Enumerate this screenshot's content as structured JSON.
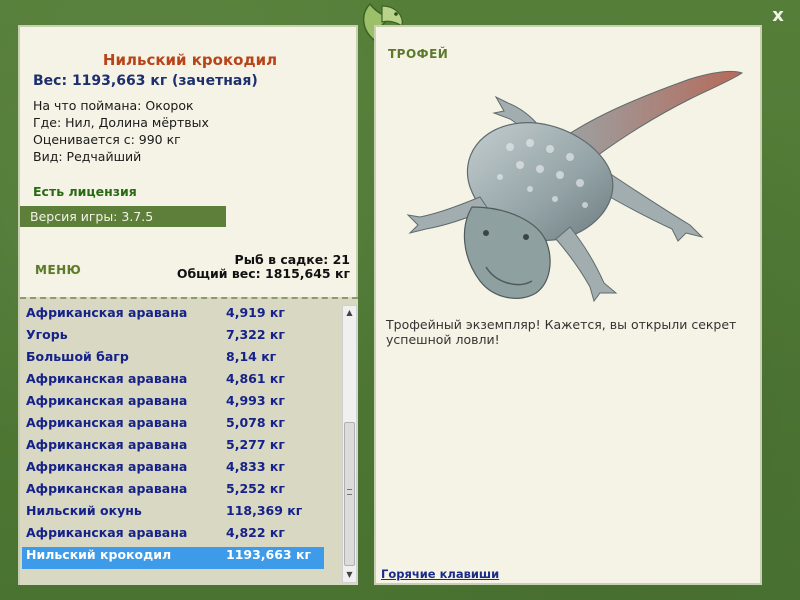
{
  "window": {
    "close_label": "x"
  },
  "catch": {
    "title": "Нильский крокодил",
    "weight_line": "Вес: 1193,663 кг (зачетная)",
    "bait": "На что поймана: Окорок",
    "location": "Где: Нил, Долина мёртвых",
    "valued_from": "Оценивается с: 990 кг",
    "rarity": "Вид: Редчайший"
  },
  "license_text": "Есть лицензия",
  "version_text": "Версия игры: 3.7.5",
  "menu_label": "МЕНЮ",
  "cage": {
    "count_line": "Рыб в садке: 21",
    "total_line": "Общий вес: 1815,645 кг"
  },
  "fish_list": [
    {
      "name": "Африканская аравана",
      "weight": "4,919 кг"
    },
    {
      "name": "Угорь",
      "weight": "7,322 кг"
    },
    {
      "name": "Большой багр",
      "weight": "8,14 кг"
    },
    {
      "name": "Африканская аравана",
      "weight": "4,861 кг"
    },
    {
      "name": "Африканская аравана",
      "weight": "4,993 кг"
    },
    {
      "name": "Африканская аравана",
      "weight": "5,078 кг"
    },
    {
      "name": "Африканская аравана",
      "weight": "5,277 кг"
    },
    {
      "name": "Африканская аравана",
      "weight": "4,833 кг"
    },
    {
      "name": "Африканская аравана",
      "weight": "5,252 кг"
    },
    {
      "name": "Нильский окунь",
      "weight": "118,369 кг"
    },
    {
      "name": "Африканская аравана",
      "weight": "4,822 кг"
    },
    {
      "name": "Нильский крокодил",
      "weight": "1193,663 кг"
    }
  ],
  "trophy": {
    "heading": "ТРОФЕЙ",
    "text": "Трофейный экземпляр! Кажется, вы открыли секрет успешной ловли!",
    "hotkeys": "Горячие клавиши"
  },
  "colors": {
    "frame": "#4f7a35",
    "panel": "#f5f3e6",
    "title": "#b8441a",
    "list_text": "#15228a",
    "selection": "#3d9be9"
  },
  "icons": {
    "logo": "fish-logo-icon",
    "close": "close-icon",
    "trophy_image": "crocodile-trophy-image"
  }
}
